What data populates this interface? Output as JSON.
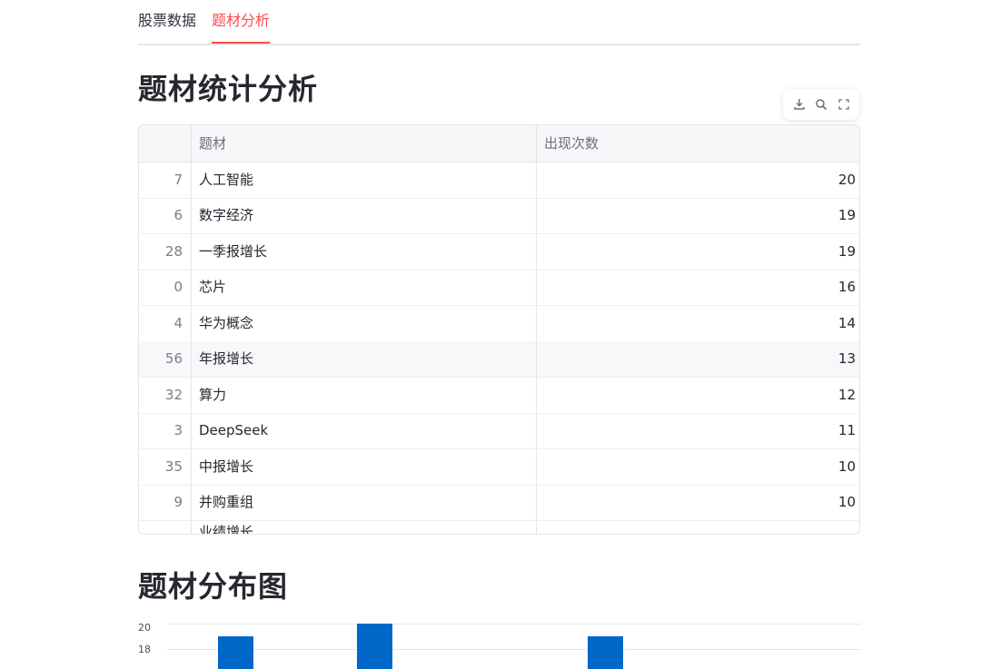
{
  "tabs": [
    "股票数据",
    "题材分析"
  ],
  "stats_section": {
    "title": "题材统计分析"
  },
  "table": {
    "columns": [
      "",
      "题材",
      "出现次数"
    ],
    "rows": [
      {
        "index": "7",
        "name": "人工智能",
        "count": "20"
      },
      {
        "index": "6",
        "name": "数字经济",
        "count": "19"
      },
      {
        "index": "28",
        "name": "一季报增长",
        "count": "19"
      },
      {
        "index": "0",
        "name": "芯片",
        "count": "16"
      },
      {
        "index": "4",
        "name": "华为概念",
        "count": "14"
      },
      {
        "index": "56",
        "name": "年报增长",
        "count": "13"
      },
      {
        "index": "32",
        "name": "算力",
        "count": "12"
      },
      {
        "index": "3",
        "name": "DeepSeek",
        "count": "11"
      },
      {
        "index": "35",
        "name": "中报增长",
        "count": "10"
      },
      {
        "index": "9",
        "name": "并购重组",
        "count": "10"
      }
    ],
    "partial_row_name": "业绩增长"
  },
  "toolbar": {
    "icons": [
      "download-icon",
      "search-icon",
      "fullscreen-icon"
    ]
  },
  "chart_section": {
    "title": "题材分布图"
  },
  "chart_data": {
    "type": "bar",
    "y_ticks": [
      "20",
      "18"
    ],
    "ylim_visible": [
      16.5,
      20.4
    ],
    "values": [
      19,
      20,
      19
    ],
    "color": "#0068c9"
  }
}
